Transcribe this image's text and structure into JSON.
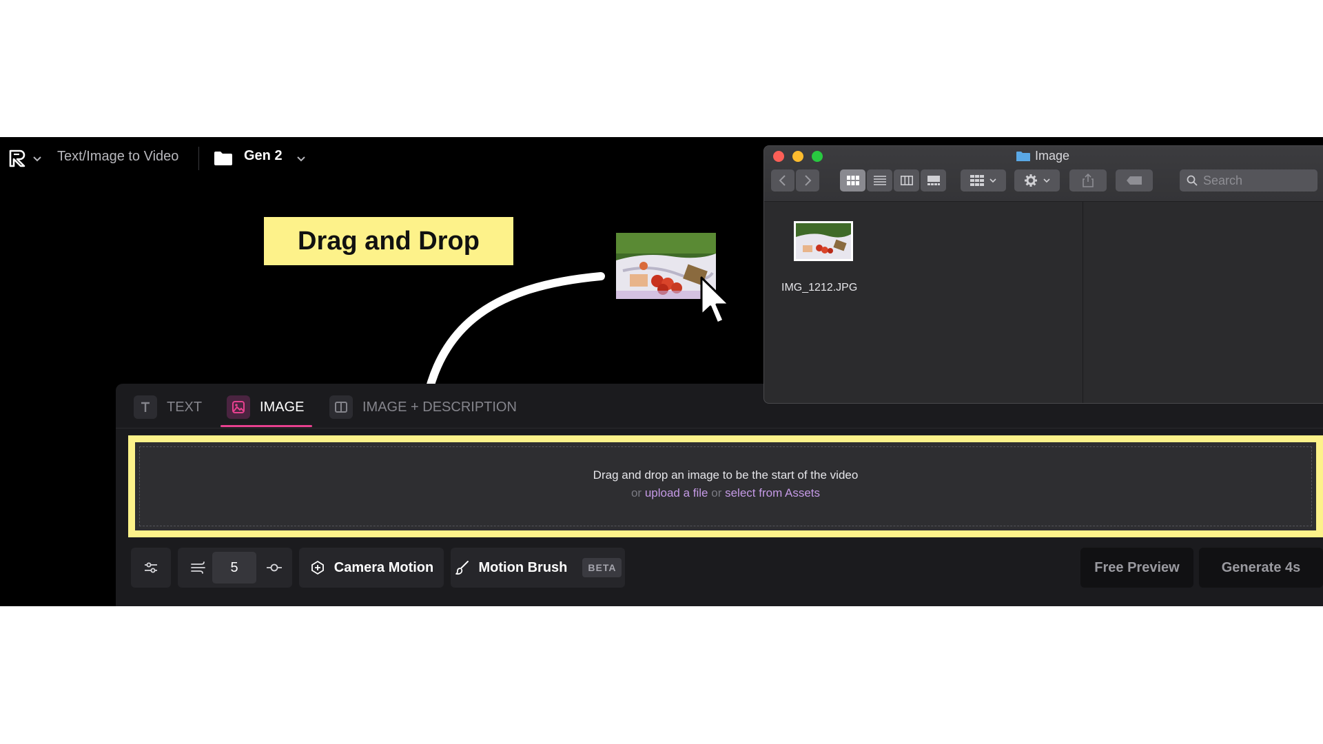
{
  "header": {
    "app_title": "Text/Image to Video",
    "project_name": "Gen 2",
    "logo_icon": "runway-logo-icon",
    "folder_icon": "folder-icon"
  },
  "overlay": {
    "callout_text": "Drag and Drop"
  },
  "tabs": [
    {
      "label": "TEXT",
      "icon": "text-icon",
      "active": false
    },
    {
      "label": "IMAGE",
      "icon": "image-icon",
      "active": true
    },
    {
      "label": "IMAGE + DESCRIPTION",
      "icon": "split-view-icon",
      "active": false
    }
  ],
  "dropzone": {
    "main_text": "Drag and drop an image to be the start of the video",
    "or1": "or",
    "upload_link": "upload a file",
    "or2": "or",
    "assets_link": "select from Assets"
  },
  "toolbar": {
    "seconds_value": "5",
    "camera_motion_label": "Camera Motion",
    "motion_brush_label": "Motion Brush",
    "motion_brush_badge": "BETA",
    "free_preview_label": "Free Preview",
    "generate_label": "Generate 4s"
  },
  "finder": {
    "title": "Image",
    "search_placeholder": "Search",
    "file_name": "IMG_1212.JPG"
  },
  "colors": {
    "highlight_yellow": "#fdf28a",
    "accent_pink": "#e8418f",
    "link_purple": "#c59ae6"
  }
}
